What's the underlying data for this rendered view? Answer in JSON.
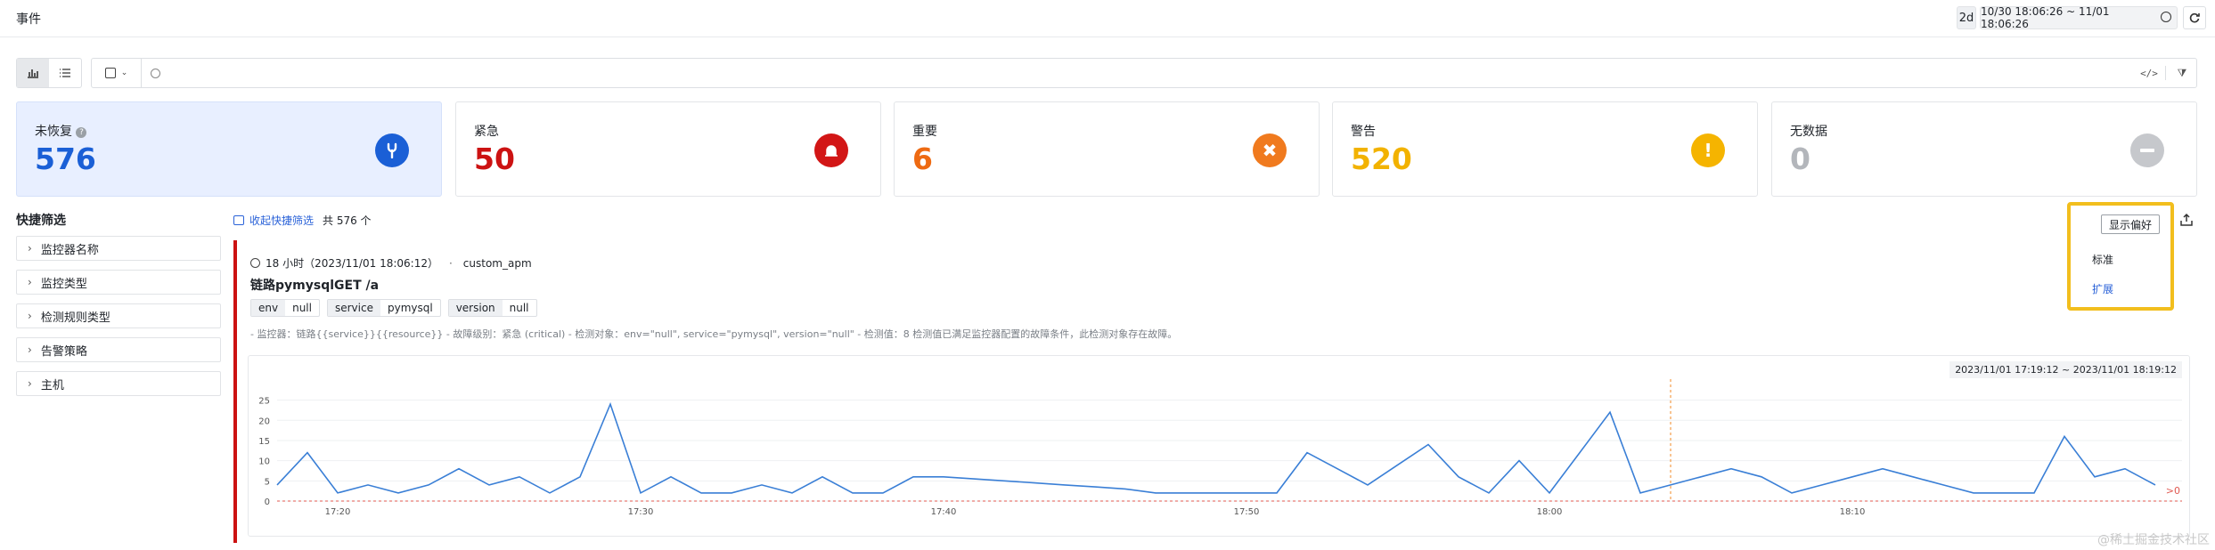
{
  "header": {
    "title": "事件",
    "range_chip": "2d",
    "time_range": "10/30 18:06:26 ~ 11/01 18:06:26"
  },
  "search": {
    "placeholder": ""
  },
  "summary_cards": [
    {
      "label": "未恢复",
      "value": "576",
      "color": "#1a5fd6",
      "icon": "wrench-icon",
      "icon_color": "#1a5fd6"
    },
    {
      "label": "紧急",
      "value": "50",
      "color": "#cc1212",
      "icon": "alarm-bell-icon",
      "icon_color": "#d21616"
    },
    {
      "label": "重要",
      "value": "6",
      "color": "#ee6a12",
      "icon": "close-circle-icon",
      "icon_color": "#f07a1e"
    },
    {
      "label": "警告",
      "value": "520",
      "color": "#f2b200",
      "icon": "exclamation-icon",
      "icon_color": "#f5b400"
    },
    {
      "label": "无数据",
      "value": "0",
      "color": "#b3b6bb",
      "icon": "minus-icon",
      "icon_color": "#c6c8cc"
    }
  ],
  "quick_filter": {
    "title": "快捷筛选",
    "items": [
      "监控器名称",
      "监控类型",
      "检测规则类型",
      "告警策略",
      "主机"
    ]
  },
  "list_bar": {
    "collapse_label": "收起快捷筛选",
    "total_label": "共 576 个"
  },
  "display_pref": {
    "button_label": "显示偏好",
    "options": [
      "标准",
      "扩展"
    ],
    "selected": "扩展"
  },
  "event": {
    "time_label": "18 小时（2023/11/01 18:06:12）",
    "source": "custom_apm",
    "title": "链路pymysqlGET /a",
    "tags": [
      {
        "key": "env",
        "value": "null"
      },
      {
        "key": "service",
        "value": "pymysql"
      },
      {
        "key": "version",
        "value": "null"
      }
    ],
    "description": "- 监控器：链路{{service}}{{resource}} - 故障级别：紧急 (critical) - 检测对象：env=\"null\", service=\"pymysql\", version=\"null\" - 检测值：8 检测值已满足监控器配置的故障条件，此检测对象存在故障。",
    "chart_range": "2023/11/01 17:19:12 ~ 2023/11/01 18:19:12"
  },
  "watermark": "@稀土掘金技术社区",
  "chart_data": {
    "type": "line",
    "x_start": "17:18:00",
    "x_interval_min": 1,
    "xticks": [
      "17:20",
      "17:30",
      "17:40",
      "17:50",
      "18:00",
      "18:10"
    ],
    "yticks": [
      "0",
      "5",
      "10",
      "15",
      "20",
      "25"
    ],
    "ylim": [
      0,
      28
    ],
    "series": [
      {
        "values": [
          4,
          12,
          2,
          4,
          2,
          4,
          8,
          4,
          6,
          2,
          6,
          24,
          2,
          6,
          2,
          2,
          4,
          2,
          6,
          2,
          2,
          6,
          6,
          5.5,
          5,
          4.5,
          4,
          3.5,
          3,
          2,
          2,
          2,
          2,
          2,
          12,
          8,
          4,
          9,
          14,
          6,
          2,
          10,
          2,
          12,
          22,
          2,
          4,
          6,
          8,
          6,
          2,
          4,
          6,
          8,
          6,
          4,
          2,
          2,
          2,
          16,
          6,
          8,
          4
        ],
        "color": "#3a7fd6"
      }
    ],
    "threshold": {
      "value": 0,
      "label": ">0",
      "color": "#e05a52"
    },
    "marker_x": "18:04"
  }
}
